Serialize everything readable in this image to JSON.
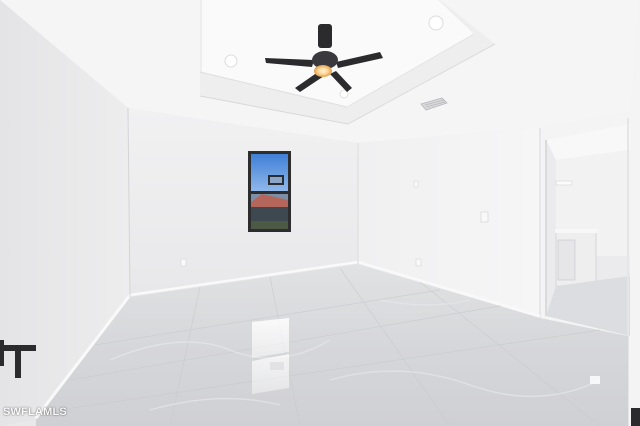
{
  "photo": {
    "watermark": "SWFLAMLS"
  },
  "palette": {
    "wall_light": "#f3f3f4",
    "wall_shade": "#e2e2e4",
    "ceiling": "#f7f7f8",
    "floor": "#d9dadd",
    "sky": "#4a86d8",
    "fan_dark": "#2b2b2e",
    "light_glow": "#ffd89a"
  }
}
